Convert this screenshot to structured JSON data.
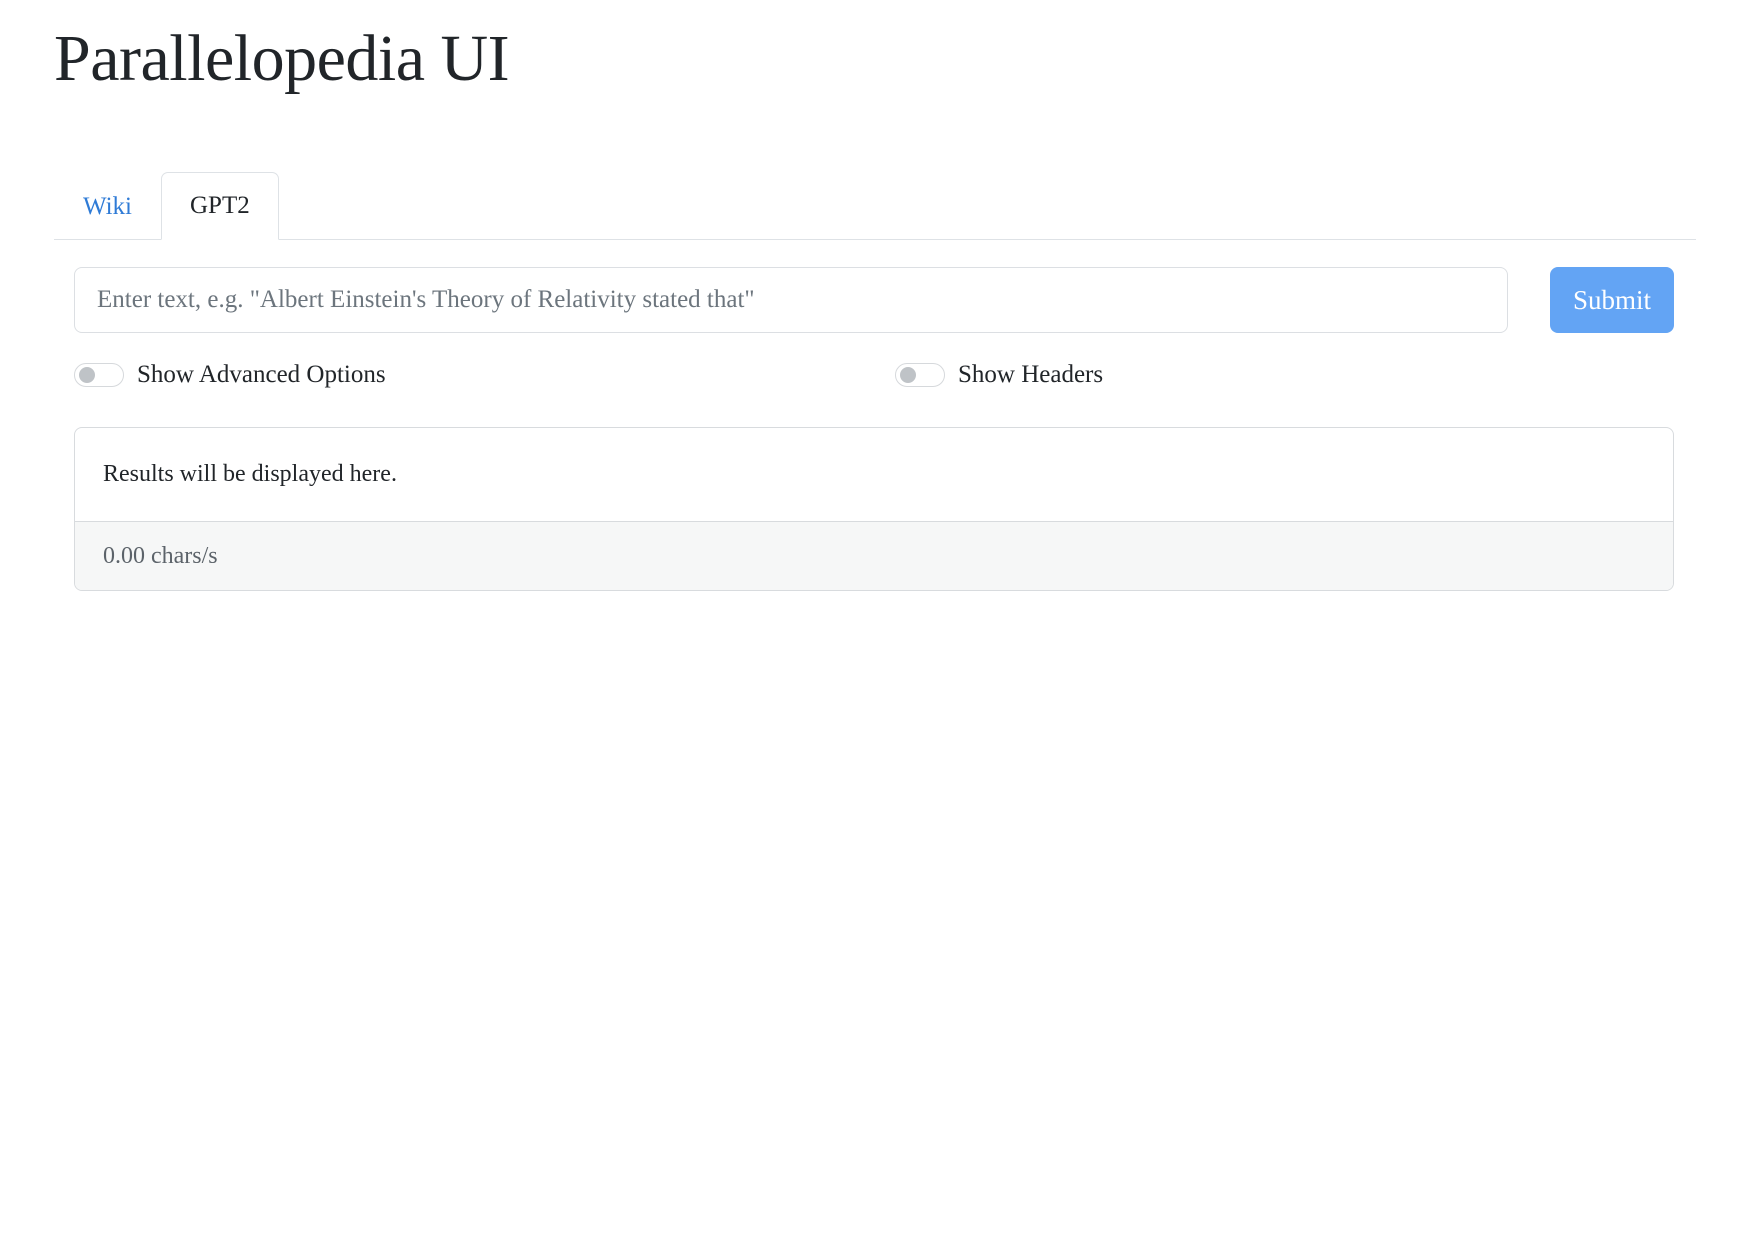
{
  "header": {
    "title": "Parallelopedia UI"
  },
  "tabs": [
    {
      "label": "Wiki",
      "active": false
    },
    {
      "label": "GPT2",
      "active": true
    }
  ],
  "query": {
    "value": "",
    "placeholder": "Enter text, e.g. \"Albert Einstein's Theory of Relativity stated that\"",
    "submit_label": "Submit"
  },
  "toggles": [
    {
      "label": "Show Advanced Options",
      "checked": false
    },
    {
      "label": "Show Headers",
      "checked": false
    }
  ],
  "results": {
    "message": "Results will be displayed here.",
    "speed": "0.00 chars/s"
  },
  "colors": {
    "accent": "#63a4f4",
    "link": "#2f7bd6"
  }
}
